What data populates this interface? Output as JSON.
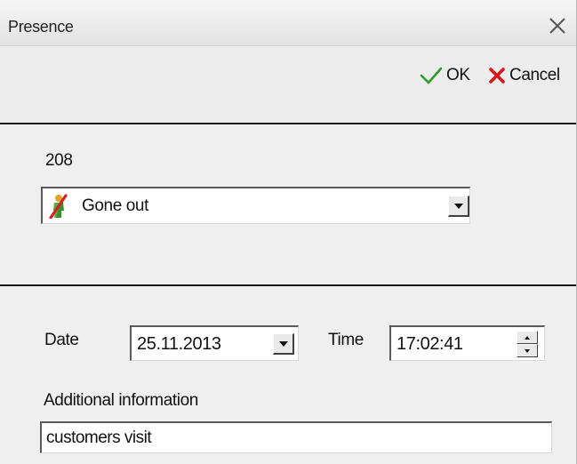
{
  "window": {
    "title": "Presence",
    "close_icon": "close-icon"
  },
  "toolbar": {
    "ok_label": "OK",
    "ok_icon": "checkmark-icon",
    "ok_color": "#2e9a2e",
    "cancel_label": "Cancel",
    "cancel_icon": "x-icon",
    "cancel_color": "#d81818"
  },
  "presence": {
    "id": "208",
    "status": {
      "icon": "person-gone-out-icon",
      "label": "Gone out"
    }
  },
  "details": {
    "date_label": "Date",
    "date_value": "25.11.2013",
    "time_label": "Time",
    "time_value": "17:02:41",
    "info_label": "Additional information",
    "info_value": "customers visit"
  }
}
